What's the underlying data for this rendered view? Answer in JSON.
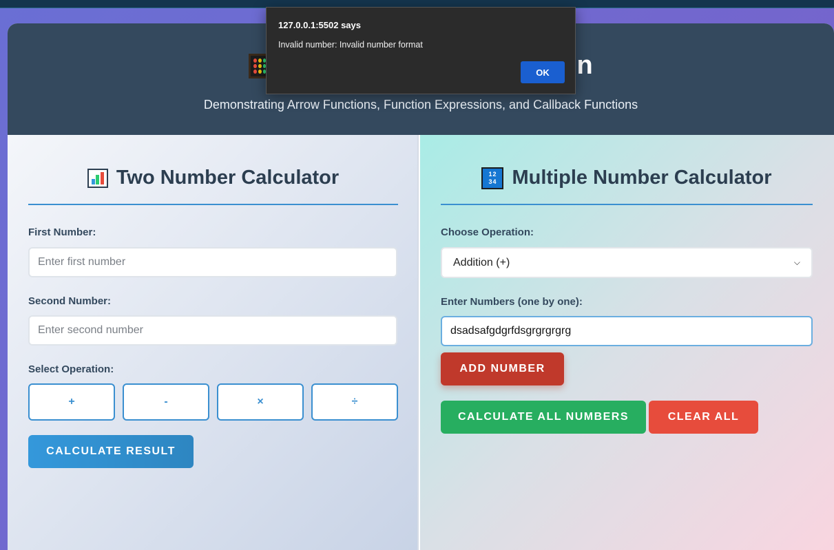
{
  "header": {
    "title": "tion",
    "subtitle": "Demonstrating Arrow Functions, Function Expressions, and Callback Functions"
  },
  "dialog": {
    "title": "127.0.0.1:5502 says",
    "message": "Invalid number: Invalid number format",
    "ok_label": "OK"
  },
  "two_number": {
    "title": "Two Number Calculator",
    "first_label": "First Number:",
    "first_placeholder": "Enter first number",
    "second_label": "Second Number:",
    "second_placeholder": "Enter second number",
    "operation_label": "Select Operation:",
    "operations": [
      "+",
      "-",
      "×",
      "÷"
    ],
    "calculate_label": "Calculate Result"
  },
  "multi_number": {
    "title": "Multiple Number Calculator",
    "operation_label": "Choose Operation:",
    "selected_operation": "Addition (+)",
    "numbers_label": "Enter Numbers (one by one):",
    "numbers_value": "dsadsafgdgrfdsgrgrgrgrg",
    "add_label": "Add Number",
    "calculate_all_label": "Calculate All Numbers",
    "clear_label": "Clear All"
  },
  "icons": {
    "header": "abacus-icon",
    "two_number": "bar-chart-icon",
    "multi_number": "numpad-icon"
  }
}
